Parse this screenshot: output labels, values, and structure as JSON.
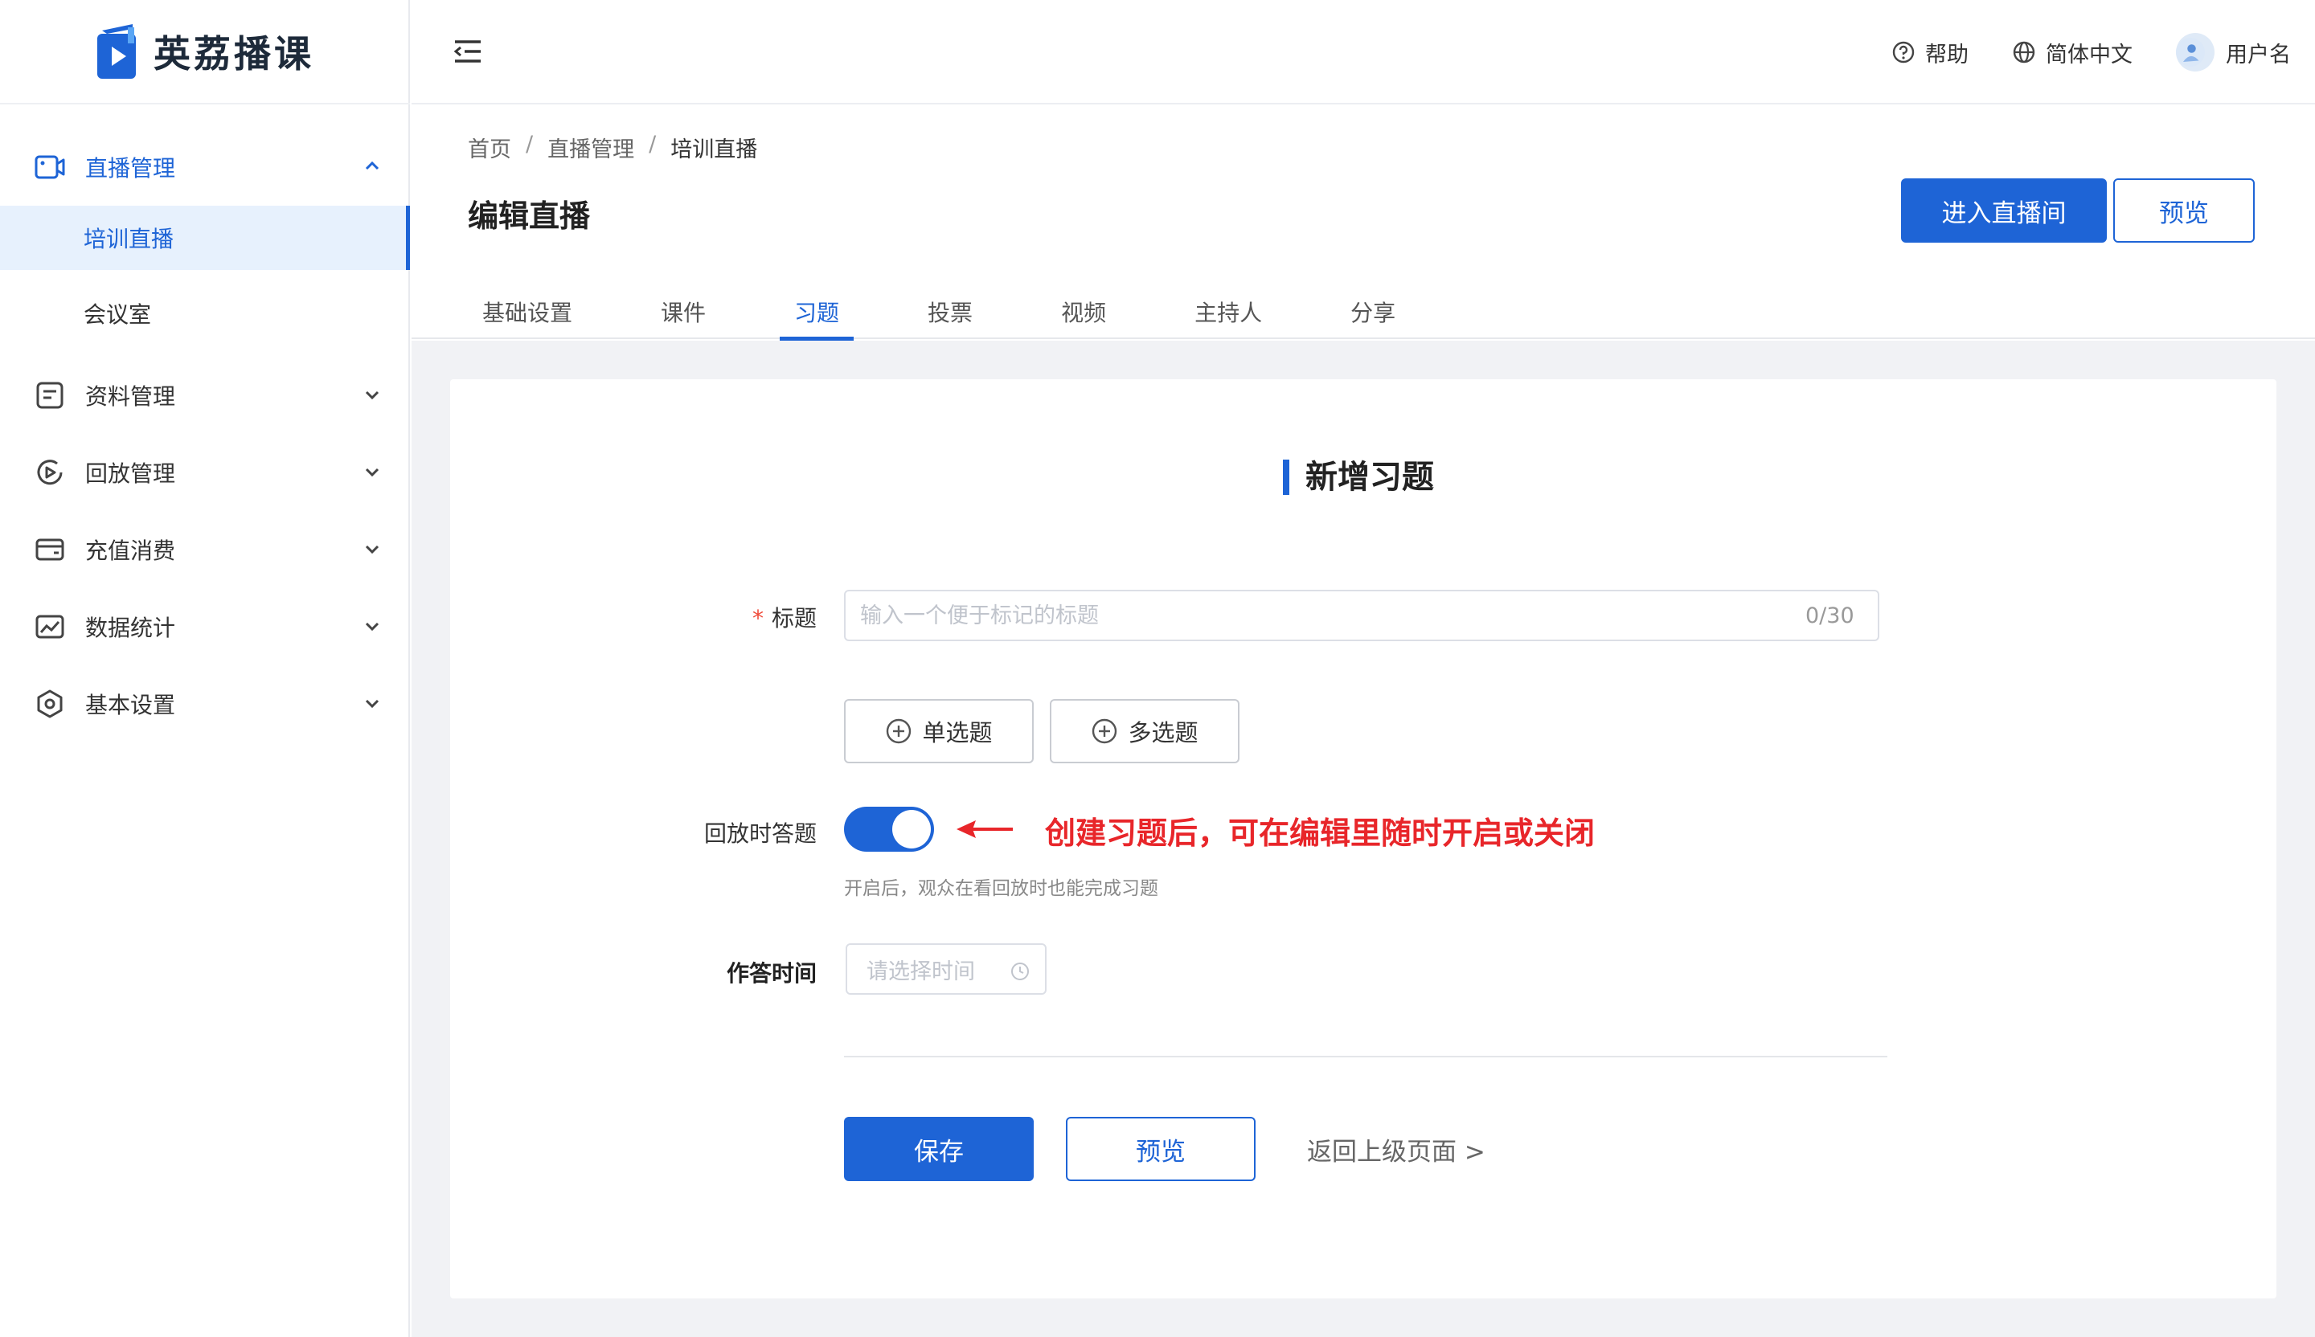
{
  "app": {
    "name": "英荔播课"
  },
  "colors": {
    "primary": "#1e64d6",
    "required": "#f04c3b",
    "annotation": "#e8262a",
    "content_bg": "#f1f2f5"
  },
  "sidebar": {
    "items": [
      {
        "label": "直播管理",
        "icon": "video-camera-icon",
        "expanded": true,
        "children": [
          {
            "label": "培训直播",
            "active": true
          },
          {
            "label": "会议室",
            "active": false
          }
        ]
      },
      {
        "label": "资料管理",
        "icon": "document-icon",
        "expanded": false
      },
      {
        "label": "回放管理",
        "icon": "replay-icon",
        "expanded": false
      },
      {
        "label": "充值消费",
        "icon": "wallet-icon",
        "expanded": false
      },
      {
        "label": "数据统计",
        "icon": "chart-image-icon",
        "expanded": false
      },
      {
        "label": "基本设置",
        "icon": "settings-hexagon-icon",
        "expanded": false
      }
    ]
  },
  "topbar": {
    "help": "帮助",
    "language": "简体中文",
    "username": "用户名"
  },
  "breadcrumb": {
    "items": [
      "首页",
      "直播管理",
      "培训直播"
    ],
    "separator": "/"
  },
  "page": {
    "title": "编辑直播",
    "enter_room_button": "进入直播间",
    "preview_button": "预览"
  },
  "tabs": {
    "items": [
      "基础设置",
      "课件",
      "习题",
      "投票",
      "视频",
      "主持人",
      "分享"
    ],
    "active": "习题"
  },
  "form": {
    "section_title": "新增习题",
    "title_field": {
      "required_mark": "*",
      "label": "标题",
      "placeholder": "输入一个便于标记的标题",
      "value": "",
      "counter": "0/30"
    },
    "single_choice_button": "单选题",
    "multiple_choice_button": "多选题",
    "replay_answer": {
      "label": "回放时答题",
      "enabled": true,
      "help": "开启后，观众在看回放时也能完成习题"
    },
    "annotation": "创建习题后，可在编辑里随时开启或关闭",
    "answer_time": {
      "label": "作答时间",
      "placeholder": "请选择时间"
    },
    "save_button": "保存",
    "preview_button": "预览",
    "return_link": "返回上级页面 >"
  }
}
